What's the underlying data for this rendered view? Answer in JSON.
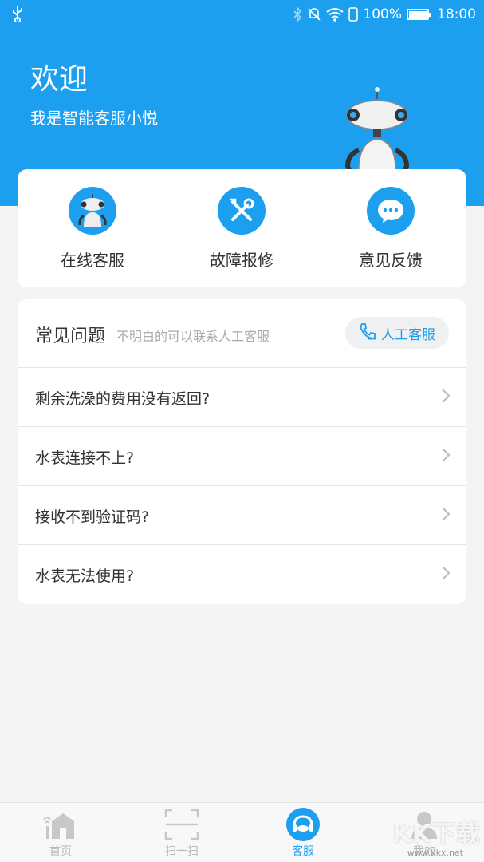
{
  "status_bar": {
    "battery": "100%",
    "time": "18:00",
    "icons": [
      "usb-icon",
      "bluetooth-icon",
      "mute-icon",
      "wifi-icon",
      "sim-icon",
      "battery-icon"
    ]
  },
  "header": {
    "title": "欢迎",
    "subtitle": "我是智能客服小悦",
    "background": "#1d9ff0"
  },
  "actions": [
    {
      "label": "在线客服",
      "icon": "robot-icon"
    },
    {
      "label": "故障报修",
      "icon": "tools-icon"
    },
    {
      "label": "意见反馈",
      "icon": "chat-bubble-icon"
    }
  ],
  "faq": {
    "title": "常见问题",
    "hint": "不明白的可以联系人工客服",
    "service_button": "人工客服",
    "questions": [
      "剩余洗澡的费用没有返回?",
      "水表连接不上?",
      "接收不到验证码?",
      "水表无法使用?"
    ]
  },
  "tabs": [
    {
      "label": "首页",
      "icon": "home-icon",
      "active": false
    },
    {
      "label": "扫一扫",
      "icon": "scan-icon",
      "active": false
    },
    {
      "label": "客服",
      "icon": "customer-service-icon",
      "active": true
    },
    {
      "label": "我的",
      "icon": "profile-icon",
      "active": false
    }
  ],
  "watermark": {
    "text": "KK下载",
    "sub": "www.kkx.net"
  },
  "colors": {
    "accent": "#1d9ff0",
    "inactive": "#b8b8b8"
  }
}
